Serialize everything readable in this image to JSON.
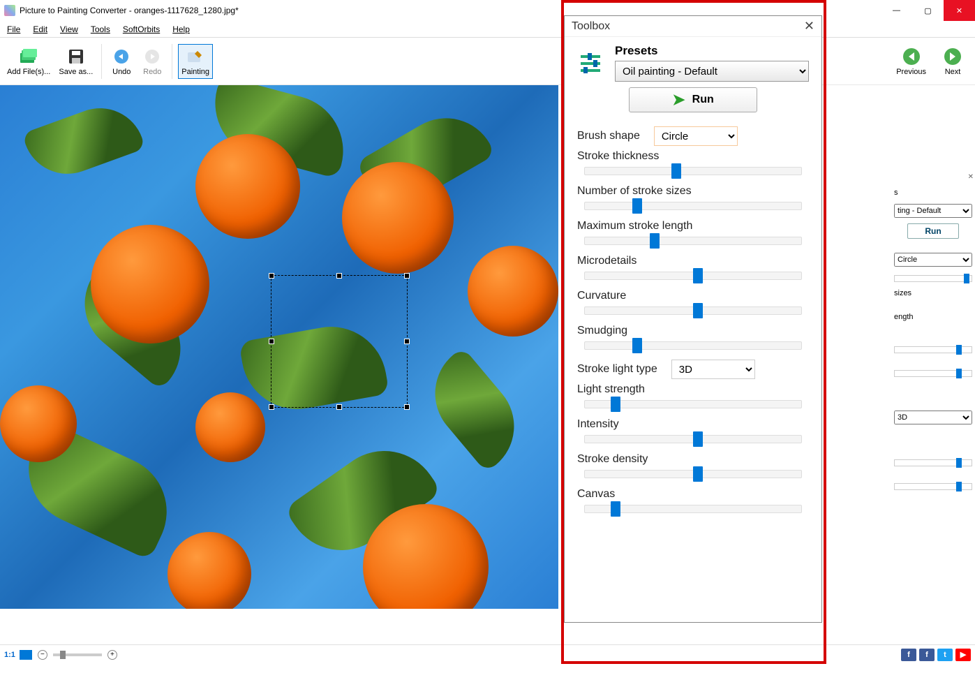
{
  "app": {
    "title": "Picture to Painting Converter - oranges-1117628_1280.jpg*"
  },
  "menu": {
    "file": "File",
    "edit": "Edit",
    "view": "View",
    "tools": "Tools",
    "softorbits": "SoftOrbits",
    "help": "Help"
  },
  "toolbar": {
    "add_files": "Add File(s)...",
    "save_as": "Save as...",
    "undo": "Undo",
    "redo": "Redo",
    "painting": "Painting",
    "previous": "Previous",
    "next": "Next"
  },
  "toolbox": {
    "title": "Toolbox",
    "presets_label": "Presets",
    "preset_value": "Oil painting - Default",
    "run": "Run",
    "brush_shape_label": "Brush shape",
    "brush_shape_value": "Circle",
    "sliders": {
      "stroke_thickness": {
        "label": "Stroke thickness",
        "pos": 40
      },
      "number_stroke_sizes": {
        "label": "Number of stroke sizes",
        "pos": 22
      },
      "max_stroke_length": {
        "label": "Maximum stroke length",
        "pos": 30
      },
      "microdetails": {
        "label": "Microdetails",
        "pos": 50
      },
      "curvature": {
        "label": "Curvature",
        "pos": 50
      },
      "smudging": {
        "label": "Smudging",
        "pos": 22
      }
    },
    "stroke_light_type_label": "Stroke light type",
    "stroke_light_type_value": "3D",
    "sliders2": {
      "light_strength": {
        "label": "Light strength",
        "pos": 12
      },
      "intensity": {
        "label": "Intensity",
        "pos": 50
      },
      "stroke_density": {
        "label": "Stroke density",
        "pos": 50
      },
      "canvas": {
        "label": "Canvas",
        "pos": 12
      }
    }
  },
  "right_panel": {
    "preset_frag": "ting - Default",
    "run": "Run",
    "brush_value": "Circle",
    "labels": {
      "sizes": "sizes",
      "length": "ength"
    },
    "light_value": "3D"
  },
  "status": {
    "ratio": "1:1"
  }
}
